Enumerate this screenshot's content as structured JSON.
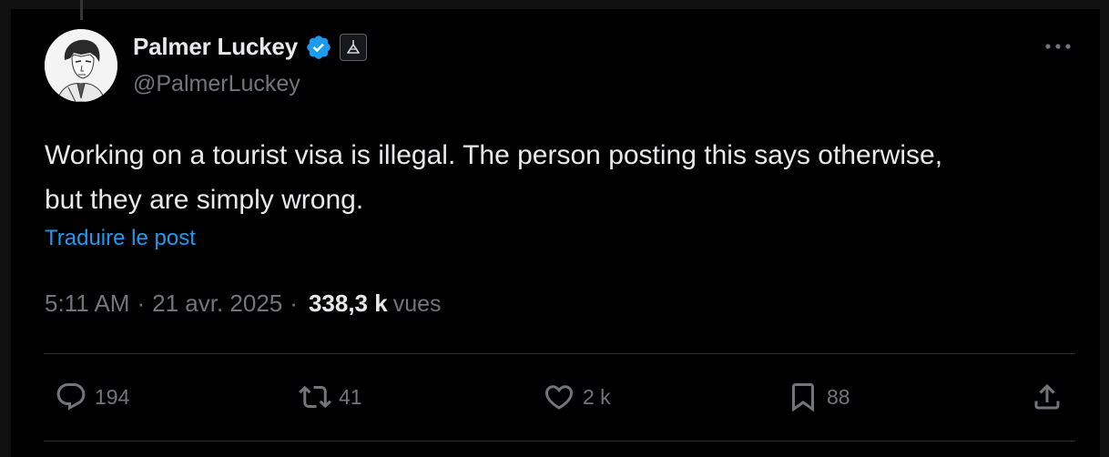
{
  "author": {
    "name": "Palmer Luckey",
    "handle": "@PalmerLuckey",
    "verified": true,
    "verified_color": "#1d9bf0",
    "affiliation_icon": "affiliation-badge-icon"
  },
  "post": {
    "text": "Working on a tourist visa is illegal.  The person posting this says otherwise, but they are simply wrong.",
    "translate_label": "Traduire le post"
  },
  "meta": {
    "time": "5:11 AM",
    "separator": "·",
    "date": "21 avr. 2025",
    "views_count": "338,3 k",
    "views_label": "vues"
  },
  "actions": {
    "replies": "194",
    "retweets": "41",
    "likes": "2 k",
    "bookmarks": "88"
  },
  "colors": {
    "background": "#000000",
    "text": "#e7e9ea",
    "muted": "#71767b",
    "accent": "#1d9bf0",
    "divider": "#2f3336"
  }
}
